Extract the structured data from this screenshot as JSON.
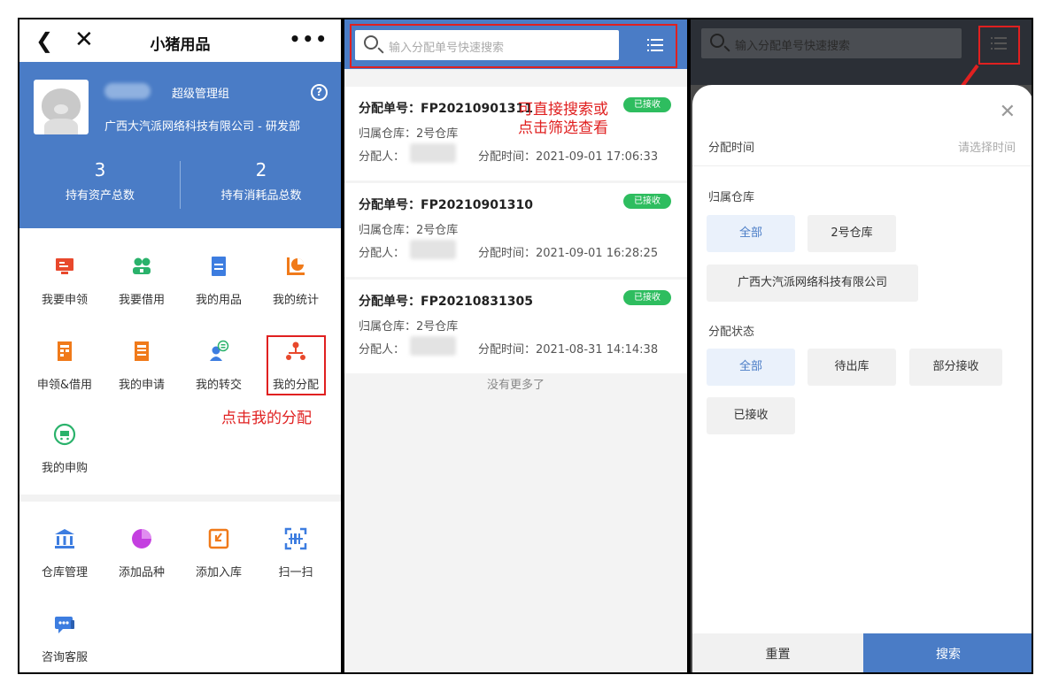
{
  "panel1": {
    "back_icon": "chevron-left-icon",
    "close_icon": "close-icon",
    "title": "小猪用品",
    "more_icon": "more-icon",
    "role": "超级管理组",
    "company": "广西大汽派网络科技有限公司 - 研发部",
    "stats": [
      {
        "num": "3",
        "label": "持有资产总数"
      },
      {
        "num": "2",
        "label": "持有消耗品总数"
      }
    ],
    "menu": [
      {
        "label": "我要申领",
        "icon": "monitor-icon",
        "color": "#e8482c"
      },
      {
        "label": "我要借用",
        "icon": "users-icon",
        "color": "#2ab26b"
      },
      {
        "label": "我的用品",
        "icon": "document-icon",
        "color": "#3d7de0"
      },
      {
        "label": "我的统计",
        "icon": "pie-chart-icon",
        "color": "#f07a1a"
      },
      {
        "label": "申领&借用",
        "icon": "form-icon",
        "color": "#f07a1a"
      },
      {
        "label": "我的申请",
        "icon": "form-icon",
        "color": "#f07a1a"
      },
      {
        "label": "我的转交",
        "icon": "transfer-icon",
        "color": "#3d7de0"
      },
      {
        "label": "我的分配",
        "icon": "org-icon",
        "color": "#e8482c"
      },
      {
        "label": "我的申购",
        "icon": "cart-icon",
        "color": "#2ab26b"
      }
    ],
    "menu2": [
      {
        "label": "仓库管理",
        "icon": "bank-icon",
        "color": "#3d7de0"
      },
      {
        "label": "添加品种",
        "icon": "pie-icon",
        "color": "#c43fe0"
      },
      {
        "label": "添加入库",
        "icon": "inbox-icon",
        "color": "#f07a1a"
      },
      {
        "label": "扫一扫",
        "icon": "scan-icon",
        "color": "#3d7de0"
      },
      {
        "label": "咨询客服",
        "icon": "chat-icon",
        "color": "#3d7de0"
      }
    ],
    "annotation": "点击我的分配"
  },
  "panel2": {
    "search_placeholder": "输入分配单号快速搜索",
    "annotation_line1": "可直接搜索或",
    "annotation_line2": "点击筛选查看",
    "warehouse_label": "归属仓库：",
    "assignee_label": "分配人：",
    "time_label": "分配时间：",
    "cards": [
      {
        "no": "分配单号：FP20210901311",
        "status": "已接收",
        "warehouse": "2号仓库",
        "time": "2021-09-01 17:06:33"
      },
      {
        "no": "分配单号：FP20210901310",
        "status": "已接收",
        "warehouse": "2号仓库",
        "time": "2021-09-01 16:28:25"
      },
      {
        "no": "分配单号：FP20210831305",
        "status": "已接收",
        "warehouse": "2号仓库",
        "time": "2021-08-31 14:14:38"
      }
    ],
    "no_more": "没有更多了",
    "accent": "#4a7cc6",
    "badge_color": "#2ebd5f"
  },
  "panel3": {
    "search_placeholder": "输入分配单号快速搜索",
    "time_label": "分配时间",
    "time_placeholder": "请选择时间",
    "warehouse_label": "归属仓库",
    "warehouse_options": [
      "全部",
      "2号仓库",
      "广西大汽派网络科技有限公司"
    ],
    "status_label": "分配状态",
    "status_options": [
      "全部",
      "待出库",
      "部分接收",
      "已接收"
    ],
    "reset": "重置",
    "search": "搜索"
  }
}
